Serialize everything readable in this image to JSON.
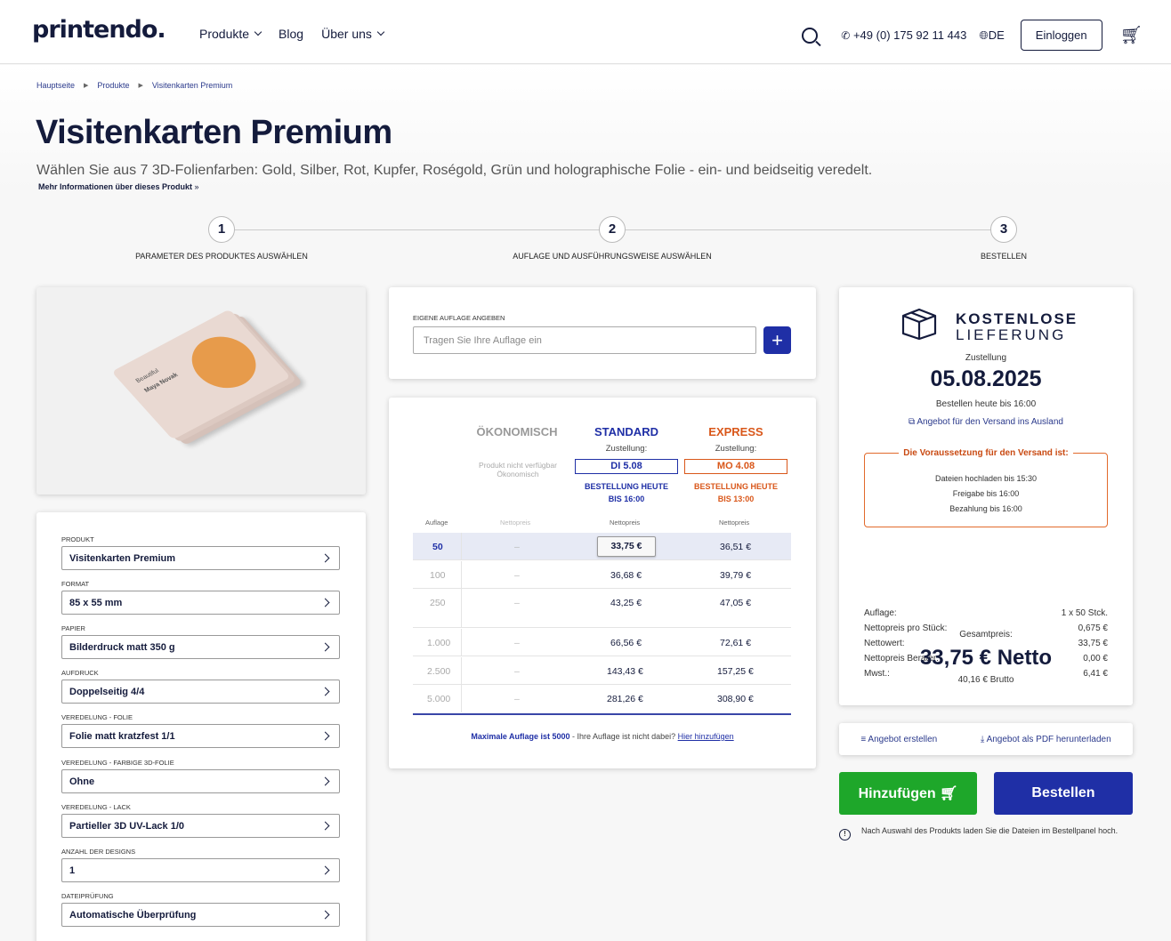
{
  "header": {
    "logo": "printendo.",
    "nav": [
      "Produkte",
      "Blog",
      "Über uns"
    ],
    "phone": "+49 (0) 175 92 11 443",
    "language": "DE",
    "login_label": "Einloggen"
  },
  "breadcrumb": [
    "Hauptseite",
    "Produkte",
    "Visitenkarten Premium"
  ],
  "product": {
    "title": "Visitenkarten Premium",
    "subtitle": "Wählen Sie aus 7 3D-Folienfarben: Gold, Silber, Rot, Kupfer, Roségold, Grün und holographische Folie - ein- und beidseitig veredelt.",
    "more_info": "Mehr Informationen über dieses Produkt",
    "image_card_text": {
      "brand": "Beautiful",
      "name": "Maya Novak"
    }
  },
  "steps": [
    {
      "num": "1",
      "label": "PARAMETER DES PRODUKTES AUSWÄHLEN"
    },
    {
      "num": "2",
      "label": "AUFLAGE UND AUSFÜHRUNGSWEISE AUSWÄHLEN"
    },
    {
      "num": "3",
      "label": "BESTELLEN"
    }
  ],
  "params": [
    {
      "label": "PRODUKT",
      "value": "Visitenkarten Premium"
    },
    {
      "label": "FORMAT",
      "value": "85 x 55 mm"
    },
    {
      "label": "PAPIER",
      "value": "Bilderdruck matt 350 g"
    },
    {
      "label": "AUFDRUCK",
      "value": "Doppelseitig 4/4"
    },
    {
      "label": "VEREDELUNG - FOLIE",
      "value": "Folie matt kratzfest 1/1"
    },
    {
      "label": "VEREDELUNG - FARBIGE 3D-FOLIE",
      "value": "Ohne"
    },
    {
      "label": "VEREDELUNG - LACK",
      "value": "Partieller 3D UV-Lack 1/0"
    },
    {
      "label": "ANZAHL DER DESIGNS",
      "value": "1"
    },
    {
      "label": "DATEIPRÜFUNG",
      "value": "Automatische Überprüfung"
    }
  ],
  "quantity": {
    "label": "EIGENE AUFLAGE ANGEBEN",
    "placeholder": "Tragen Sie Ihre Auflage ein",
    "add_symbol": "+"
  },
  "price_table": {
    "columns": {
      "eco": {
        "title": "ÖKONOMISCH",
        "note": "Produkt nicht verfügbar Ökonomisch"
      },
      "standard": {
        "title": "STANDARD",
        "sub": "Zustellung:",
        "date": "DI 5.08",
        "order": "BESTELLUNG HEUTE",
        "until": "BIS 16:00"
      },
      "express": {
        "title": "EXPRESS",
        "sub": "Zustellung:",
        "date": "MO 4.08",
        "order": "BESTELLUNG HEUTE",
        "until": "BIS 13:00"
      }
    },
    "headers": {
      "qty": "Auflage",
      "eco": "Nettopreis",
      "standard": "Nettopreis",
      "express": "Nettopreis"
    },
    "rows": [
      {
        "qty": "50",
        "eco": "–",
        "standard": "33,75 €",
        "express": "36,51 €"
      },
      {
        "qty": "100",
        "eco": "–",
        "standard": "36,68 €",
        "express": "39,79 €"
      },
      {
        "qty": "250",
        "eco": "–",
        "standard": "43,25 €",
        "express": "47,05 €"
      },
      {
        "qty": "1.000",
        "eco": "–",
        "standard": "66,56 €",
        "express": "72,61 €"
      },
      {
        "qty": "2.500",
        "eco": "–",
        "standard": "143,43 €",
        "express": "157,25 €"
      },
      {
        "qty": "5.000",
        "eco": "–",
        "standard": "281,26 €",
        "express": "308,90 €"
      }
    ],
    "max_note_bold": "Maximale Auflage ist 5000",
    "max_note_text": " - Ihre Auflage ist nicht dabei? ",
    "max_note_link": "Hier hinzufügen"
  },
  "summary": {
    "free_title_1": "KOSTENLOSE",
    "free_title_2": "LIEFERUNG",
    "delivery_label": "Zustellung",
    "delivery_date": "05.08.2025",
    "order_until": "Bestellen heute bis 16:00",
    "abroad_link": "Angebot für den Versand ins Ausland",
    "req_title": "Die Voraussetzung für den Versand ist:",
    "req_lines": [
      "Dateien hochladen bis 15:30",
      "Freigabe bis 16:00",
      "Bezahlung bis 16:00"
    ],
    "lines": [
      {
        "k": "Auflage:",
        "v": "1 x 50 Stck."
      },
      {
        "k": "Nettopreis pro Stück:",
        "v": "0,675 €"
      },
      {
        "k": "Nettowert:",
        "v": "33,75 €"
      },
      {
        "k": "Nettopreis Berater:",
        "v": "0,00 €"
      },
      {
        "k": "Mwst.:",
        "v": "6,41 €"
      }
    ],
    "total_label": "Gesamtpreis:",
    "total": "33,75 € Netto",
    "brutto": "40,16 € Brutto"
  },
  "actions": {
    "create_offer": "Angebot erstellen",
    "download_pdf": "Angebot als PDF herunterladen",
    "add_label": "Hinzufügen",
    "order_label": "Bestellen",
    "hint": "Nach Auswahl des Produkts laden Sie die Dateien im Bestellpanel hoch."
  },
  "colors": {
    "navy": "#141b3c",
    "blue": "#1f2fa6",
    "green": "#1ea72a",
    "orange": "#e26a2c",
    "standard": "#1f2fa6",
    "express": "#d9571a"
  }
}
